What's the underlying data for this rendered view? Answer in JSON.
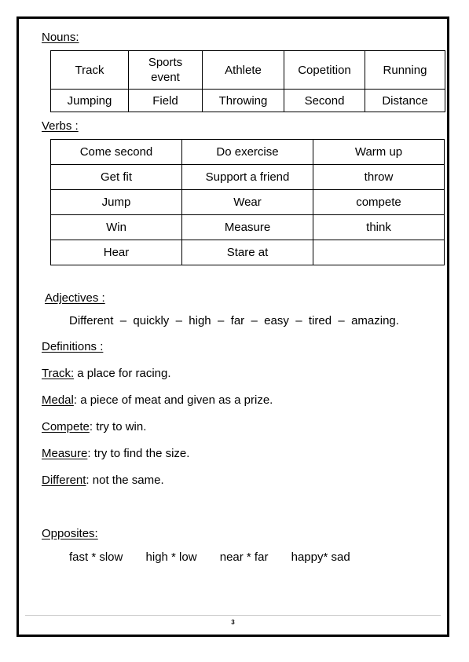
{
  "document": {
    "page_number": "3"
  },
  "sections": {
    "nouns": {
      "heading": "Nouns:",
      "table": {
        "rows": [
          [
            "Track",
            "Sports\nevent",
            "Athlete",
            "Copetition",
            "Running"
          ],
          [
            "Jumping",
            "Field",
            "Throwing",
            "Second",
            "Distance"
          ]
        ]
      }
    },
    "verbs": {
      "heading": "Verbs :",
      "table": {
        "rows": [
          [
            "Come second",
            "Do exercise",
            "Warm up"
          ],
          [
            "Get fit",
            "Support a friend",
            "throw"
          ],
          [
            "Jump",
            "Wear",
            "compete"
          ],
          [
            "Win",
            "Measure",
            "think"
          ],
          [
            "Hear",
            "Stare at",
            ""
          ]
        ]
      }
    },
    "adjectives": {
      "heading": "Adjectives :",
      "words": "Different  –  quickly  –  high  –  far  –  easy  –  tired  –  amazing."
    },
    "definitions": {
      "heading": "Definitions :",
      "items": [
        {
          "term": "Track:",
          "text": " a place for racing."
        },
        {
          "term": "Medal",
          "text": ": a piece of meat and given as a prize."
        },
        {
          "term": "Compete",
          "text": ": try to win."
        },
        {
          "term": "Measure",
          "text": ": try to find the size."
        },
        {
          "term": "Different",
          "text": ": not the same."
        }
      ]
    },
    "opposites": {
      "heading": "Opposites:",
      "pairs": "fast * slow       high * low       near * far       happy* sad"
    }
  }
}
